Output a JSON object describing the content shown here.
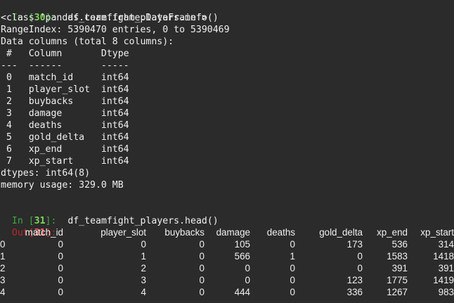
{
  "cell30": {
    "prompt": "In [",
    "num": "30",
    "close": "]:",
    "code": "df_teamfight_players.info()"
  },
  "info": {
    "class_line": "<class 'pandas.core.frame.DataFrame'>",
    "range_index": "RangeIndex: 5390470 entries, 0 to 5390469",
    "data_columns": "Data columns (total 8 columns):",
    "header": " #   Column       Dtype",
    "divider": "---  ------       -----",
    "rows": [
      " 0   match_id     int64",
      " 1   player_slot  int64",
      " 2   buybacks     int64",
      " 3   damage       int64",
      " 4   deaths       int64",
      " 5   gold_delta   int64",
      " 6   xp_end       int64",
      " 7   xp_start     int64"
    ],
    "dtypes": "dtypes: int64(8)",
    "memory": "memory usage: 329.0 MB"
  },
  "cell31": {
    "prompt": "In [",
    "num": "31",
    "close": "]:",
    "code": "df_teamfight_players.head()",
    "out_prompt": "Out[",
    "out_num": "31",
    "out_close": "]:"
  },
  "table": {
    "columns": [
      "",
      "match_id",
      "player_slot",
      "buybacks",
      "damage",
      "deaths",
      "gold_delta",
      "xp_end",
      "xp_start"
    ],
    "rows": [
      [
        "0",
        "0",
        "0",
        "0",
        "105",
        "0",
        "173",
        "536",
        "314"
      ],
      [
        "1",
        "0",
        "1",
        "0",
        "566",
        "1",
        "0",
        "1583",
        "1418"
      ],
      [
        "2",
        "0",
        "2",
        "0",
        "0",
        "0",
        "0",
        "391",
        "391"
      ],
      [
        "3",
        "0",
        "3",
        "0",
        "0",
        "0",
        "123",
        "1775",
        "1419"
      ],
      [
        "4",
        "0",
        "4",
        "0",
        "444",
        "0",
        "336",
        "1267",
        "983"
      ]
    ]
  }
}
